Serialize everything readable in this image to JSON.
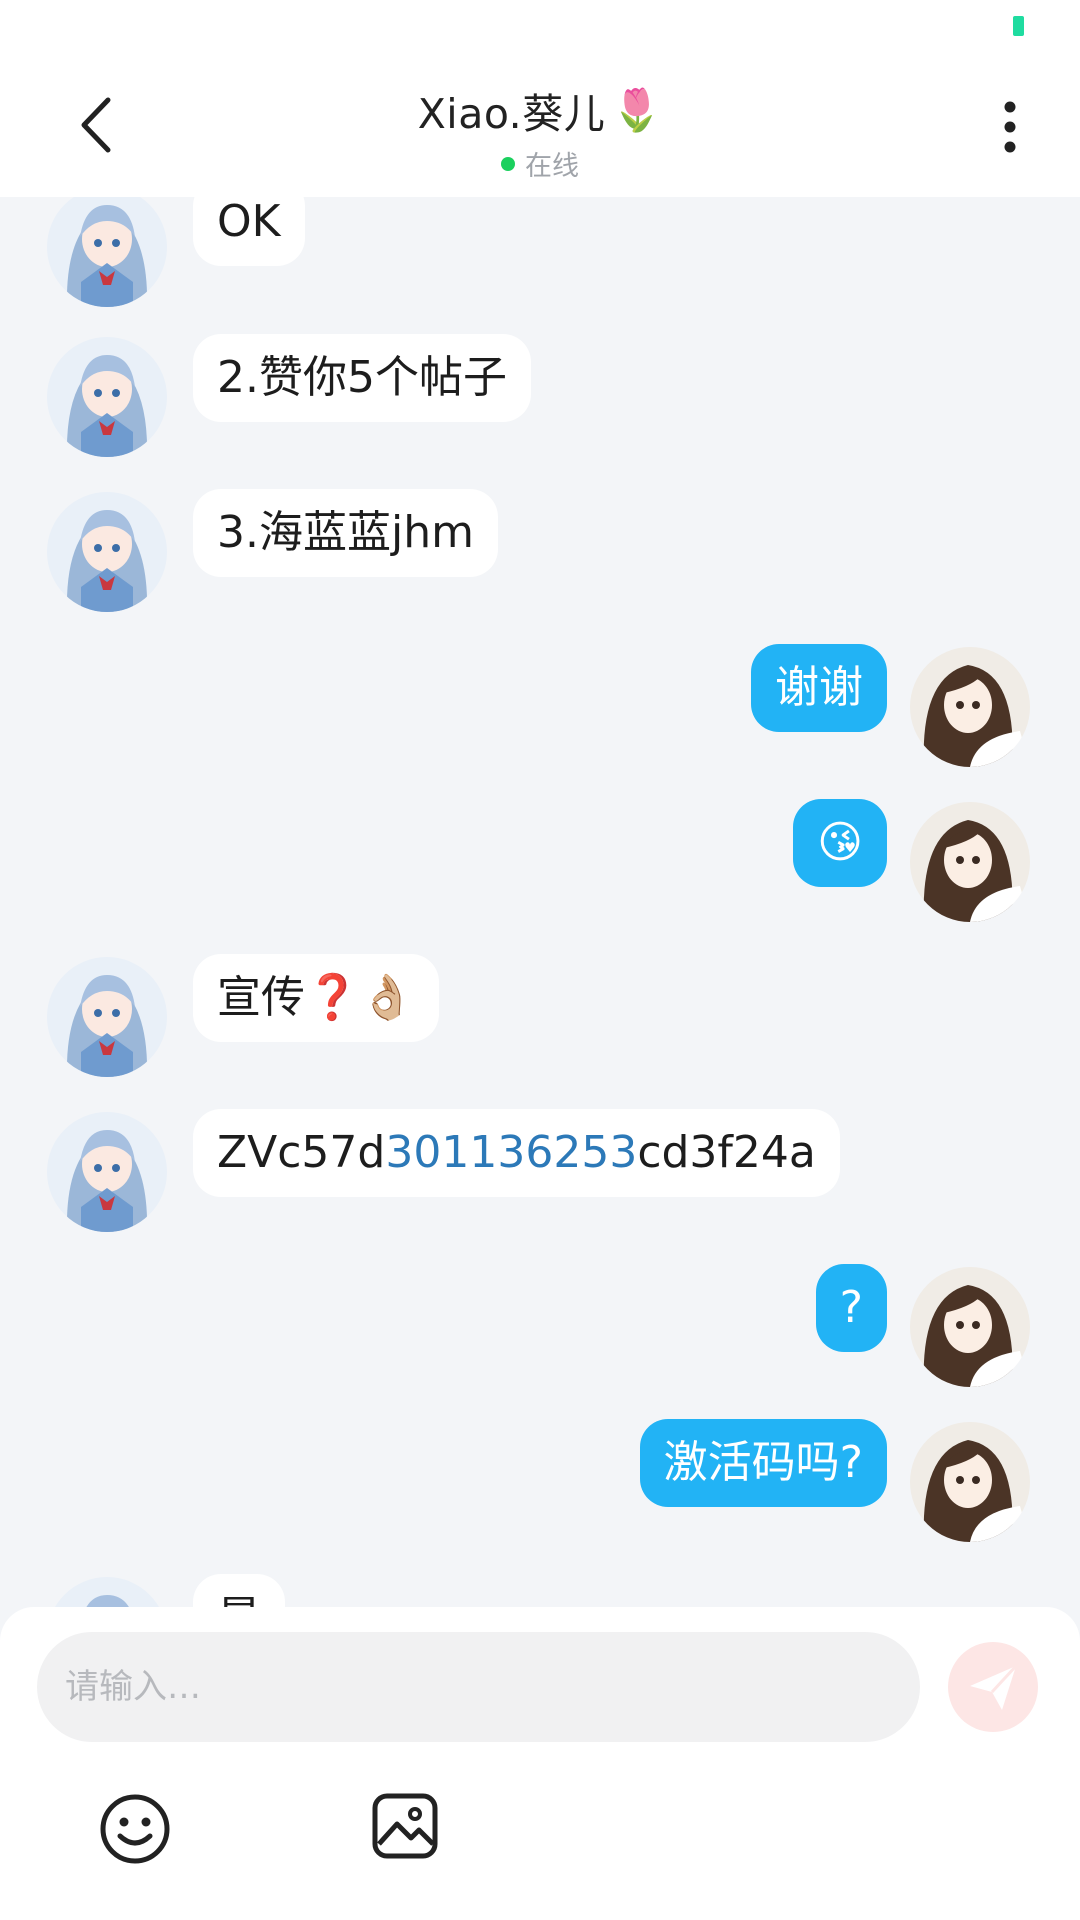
{
  "header": {
    "title": "Xiao.葵儿",
    "title_emoji": "🌷",
    "status": "在线",
    "back_icon": "chevron-left-icon",
    "more_icon": "more-vertical-icon"
  },
  "messages": [
    {
      "from": "contact",
      "text": "OK"
    },
    {
      "from": "contact",
      "text": "2.赞你5个帖子"
    },
    {
      "from": "contact",
      "text": "3.海蓝蓝jhm"
    },
    {
      "from": "me",
      "text": "谢谢"
    },
    {
      "from": "me",
      "text": "😘"
    },
    {
      "from": "contact",
      "text": "宣传❓👌🏼"
    },
    {
      "from": "contact",
      "text_parts": [
        "ZVc57d",
        "301136253",
        "cd3f24a"
      ]
    },
    {
      "from": "me",
      "text": "?"
    },
    {
      "from": "me",
      "text": "激活码吗?"
    },
    {
      "from": "contact",
      "text": "是"
    }
  ],
  "composer": {
    "placeholder": "请输入…",
    "send_icon": "send-plane-icon",
    "emoji_icon": "smiley-icon",
    "image_icon": "image-icon"
  },
  "colors": {
    "outgoing_bubble": "#22b3f5",
    "incoming_bubble": "#ffffff",
    "chat_background": "#f3f5f8",
    "online_dot": "#1bd05e",
    "link_number": "#2c79b8",
    "send_button": "#fde6e5",
    "battery": "#1fdca0"
  }
}
